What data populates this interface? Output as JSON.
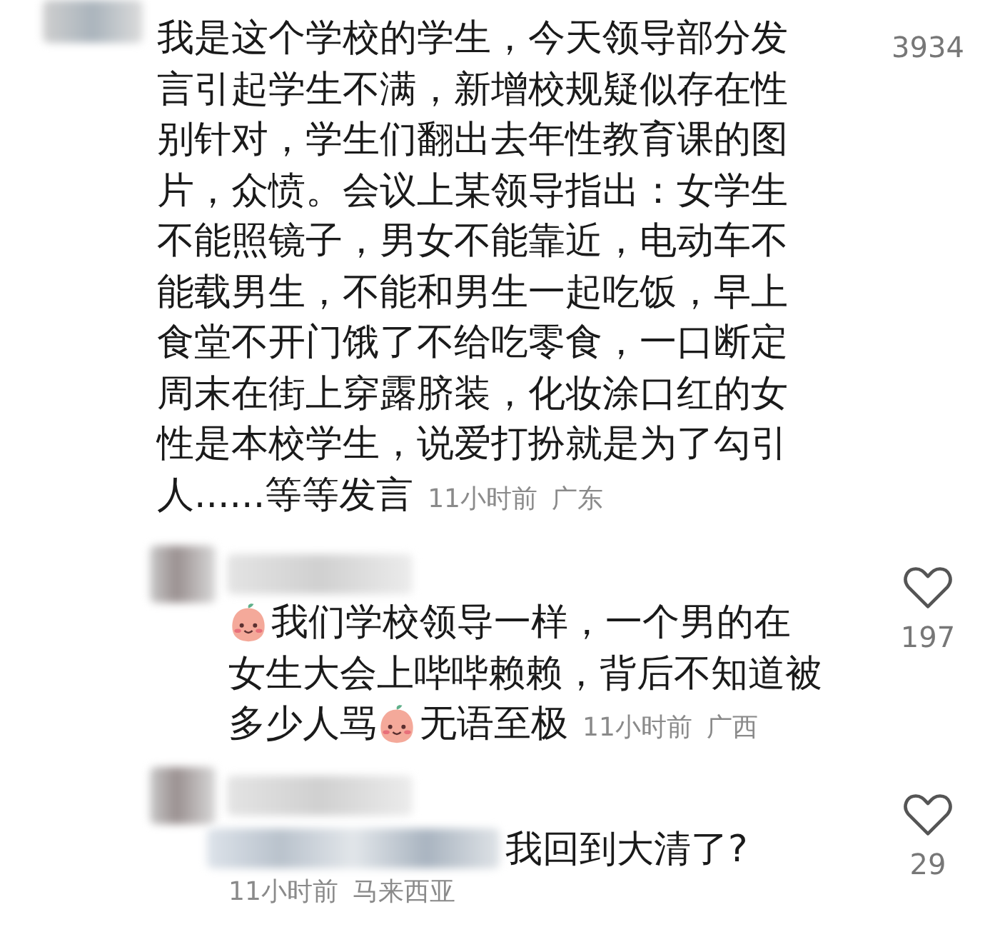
{
  "comments": [
    {
      "lines": [
        [
          {
            "kind": "text",
            "text": "我是这个学校的学生，今天领导部分发"
          }
        ],
        [
          {
            "kind": "text",
            "text": "言引起学生不满，新增校规疑似存在性"
          }
        ],
        [
          {
            "kind": "text",
            "text": "别针对，学生们翻出去年性教育课的图"
          }
        ],
        [
          {
            "kind": "text",
            "text": "片，众愤。会议上某领导指出：女学生"
          }
        ],
        [
          {
            "kind": "text",
            "text": "不能照镜子，男女不能靠近，电动车不"
          }
        ],
        [
          {
            "kind": "text",
            "text": "能载男生，不能和男生一起吃饭，早上"
          }
        ],
        [
          {
            "kind": "text",
            "text": "食堂不开门饿了不给吃零食，一口断定"
          }
        ],
        [
          {
            "kind": "text",
            "text": "周末在街上穿露脐装，化妆涂口红的女"
          }
        ],
        [
          {
            "kind": "text",
            "text": "性是本校学生，说爱打扮就是为了勾引"
          }
        ],
        [
          {
            "kind": "text",
            "text": "人......等等发言"
          },
          {
            "kind": "meta"
          }
        ]
      ],
      "time": "11小时前",
      "location": "广东",
      "likes": "3934"
    },
    {
      "lines": [
        [
          {
            "kind": "emoji"
          },
          {
            "kind": "text",
            "text": "我们学校领导一样，一个男的在"
          }
        ],
        [
          {
            "kind": "text",
            "text": "女生大会上哔哔赖赖，背后不知道被"
          }
        ],
        [
          {
            "kind": "text",
            "text": "多少人骂"
          },
          {
            "kind": "emoji"
          },
          {
            "kind": "text",
            "text": "无语至极"
          },
          {
            "kind": "meta"
          }
        ]
      ],
      "time": "11小时前",
      "location": "广西",
      "likes": "197"
    },
    {
      "lines": [
        [
          {
            "kind": "blur"
          },
          {
            "kind": "text",
            "text": "我回到大清了?"
          }
        ],
        [
          {
            "kind": "meta"
          }
        ]
      ],
      "time": "11小时前",
      "location": "马来西亚",
      "likes": "29"
    }
  ]
}
